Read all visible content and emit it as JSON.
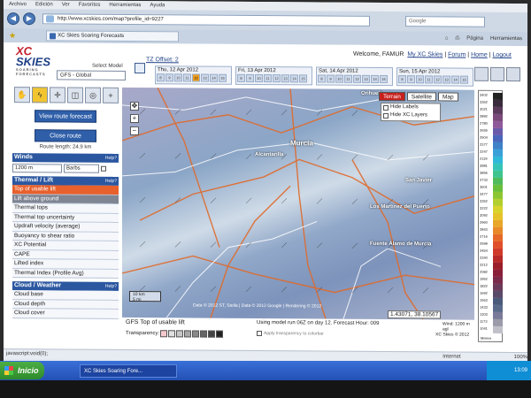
{
  "browser": {
    "menu": [
      "Archivo",
      "Edición",
      "Ver",
      "Favoritos",
      "Herramientas",
      "Ayuda"
    ],
    "url": "http://www.xcskies.com/map?profile_id=9227",
    "search_placeholder": "Google",
    "tab_title": "XC Skies Soaring Forecasts",
    "toolbar": [
      "Página",
      "Herramientas"
    ],
    "status_left": "javascript:void(0);",
    "status_zone": "Internet",
    "zoom": "100%"
  },
  "header": {
    "logo_top": "XC",
    "logo_bottom": "SKIES",
    "logo_tag": "SOARING FORECASTS",
    "select_model_label": "Select Model",
    "model": "GFS - Global",
    "tz_offset": "TZ Offset: 2",
    "welcome": "Welcome, FAMUR",
    "links": [
      "My XC Skies",
      "Forum",
      "Home",
      "Logout"
    ]
  },
  "days": [
    {
      "label": "Thu, 12 Apr 2012",
      "hours": [
        "8",
        "9",
        "10",
        "11",
        "12",
        "13",
        "14",
        "15"
      ],
      "selected": 4
    },
    {
      "label": "Fri, 13 Apr 2012",
      "hours": [
        "8",
        "9",
        "10",
        "11",
        "12",
        "13",
        "14",
        "15"
      ],
      "selected": -1
    },
    {
      "label": "Sat, 14 Apr 2012",
      "hours": [
        "8",
        "9",
        "10",
        "11",
        "12",
        "13",
        "14",
        "15"
      ],
      "selected": -1
    },
    {
      "label": "Sun, 15 Apr 2012",
      "hours": [
        "8",
        "9",
        "10",
        "11",
        "12",
        "13",
        "14",
        "15"
      ],
      "selected": -1
    }
  ],
  "sidebar": {
    "view_route": "View route forecast",
    "close_route": "Close route",
    "route_length": "Route length: 24.9 km",
    "winds_title": "Winds",
    "help": "Help?",
    "winds_level": "1200 m",
    "winds_style": "Barbs",
    "thermal_title": "Thermal / Lift",
    "thermal_items": [
      "Top of usable lift",
      "Lift above ground",
      "Thermal tops",
      "Thermal top uncertainty",
      "Updraft velocity (average)",
      "Buoyancy to shear ratio",
      "XC Potential",
      "CAPE",
      "Lifted index",
      "Thermal Index (Profile Avg)"
    ],
    "cloud_title": "Cloud / Weather",
    "cloud_items": [
      "Cloud base",
      "Cloud depth",
      "Cloud cover"
    ]
  },
  "map": {
    "buttons": [
      "Terrain",
      "Satellite",
      "Map"
    ],
    "place_top": "Orihuela",
    "hide_labels": "Hide Labels",
    "hide_xc": "Hide XC Layers",
    "cities": [
      "Murcia",
      "Alcantarilla",
      "Los Martínez del Puerto",
      "Fuente Álamo de Murcia",
      "San Javier"
    ],
    "scale_km": "10 km",
    "scale_mi": "5 mi",
    "copyright": "Data © 2012 ST, Stella | Data © 2012 Google | Rendering © 2012",
    "coords": "1.43071, 38.10567"
  },
  "below_map": {
    "layer_title": "GFS Top of usable lift",
    "transparency": "Transparency:",
    "model_info": "Using model run 06Z on day 12. Forecast Hour: 009",
    "apply_transparency": "Apply transparency to colorbar",
    "wind_info": "Wind: 1200 m agl",
    "credit": "XC Skies © 2012"
  },
  "colorbar": {
    "values": [
      "3402",
      "3362",
      "3021",
      "2892",
      "2780",
      "2655",
      "2504",
      "2377",
      "2247",
      "2119",
      "3981",
      "3856",
      "3733",
      "3601",
      "3477",
      "3352",
      "3222",
      "3092",
      "2960",
      "2843",
      "2716",
      "2599",
      "2464",
      "2340",
      "2212",
      "2082",
      "1952",
      "1822",
      "1692",
      "1563",
      "1433",
      "1303",
      "1173",
      "1041"
    ],
    "colors": [
      "#222222",
      "#3a2b3c",
      "#5a3b5c",
      "#7a4a7a",
      "#8e5a9a",
      "#6a5aaa",
      "#4a66bb",
      "#3f82c8",
      "#3aa0d8",
      "#2fb8d8",
      "#36c4b8",
      "#3fc48f",
      "#4fbb5a",
      "#6abf3a",
      "#8cc733",
      "#b3cf2e",
      "#d7d32a",
      "#e6c22a",
      "#e8a62a",
      "#e8892a",
      "#e56a2a",
      "#df4f2a",
      "#cf3a2a",
      "#b72a2a",
      "#9a1f2a",
      "#8a1f3a",
      "#7a2a4a",
      "#6a3a5a",
      "#5a4a6a",
      "#4a5a7a",
      "#5a6a8a",
      "#7a7a9a",
      "#9a9aaa",
      "#c0c0c8"
    ],
    "unit": "Meters"
  },
  "taskbar": {
    "start": "Inicio",
    "task": "XC Skies Soaring Fore...",
    "clock": "13:09"
  }
}
